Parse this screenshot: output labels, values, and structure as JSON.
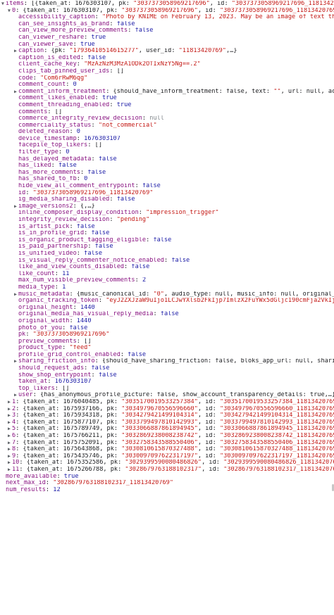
{
  "rows": [
    {
      "indent": 0,
      "tri": "down",
      "key": "items",
      "summary": "[{taken_at: 1676303107, pk: \"3037373058969217696\", id: \"3037373058969217696_1181342076\""
    },
    {
      "indent": 1,
      "tri": "down",
      "key": "0",
      "summary": "{taken_at: 1676303107, pk: \"3037373058969217696\", id: \"3037373058969217696_11813420769\","
    },
    {
      "indent": 2,
      "key": "accessibility_caption",
      "type": "s",
      "value": "\"Photo by KNIME on February 13, 2023. May be an image of text that"
    },
    {
      "indent": 2,
      "key": "can_see_insights_as_brand",
      "type": "b",
      "value": "false"
    },
    {
      "indent": 2,
      "key": "can_view_more_preview_comments",
      "type": "b",
      "value": "false"
    },
    {
      "indent": 2,
      "key": "can_viewer_reshare",
      "type": "b",
      "value": "true"
    },
    {
      "indent": 2,
      "key": "can_viewer_save",
      "type": "b",
      "value": "true"
    },
    {
      "indent": 2,
      "tri": "right",
      "key": "caption",
      "summary": "{pk: \"17936410514615277\", user_id: \"11813420769\",…}"
    },
    {
      "indent": 2,
      "key": "caption_is_edited",
      "type": "b",
      "value": "false"
    },
    {
      "indent": 2,
      "key": "client_cache_key",
      "type": "s",
      "value": "\"MzAzNzM3MzA1ODk2OTIxNzY5Ng==.2\""
    },
    {
      "indent": 2,
      "key": "clips_tab_pinned_user_ids",
      "type": "p",
      "value": "[]"
    },
    {
      "indent": 2,
      "key": "code",
      "type": "s",
      "value": "\"Com6rRwM6qg\""
    },
    {
      "indent": 2,
      "key": "comment_count",
      "type": "n",
      "value": "0"
    },
    {
      "indent": 2,
      "tri": "right",
      "key": "comment_inform_treatment",
      "summary": "{should_have_inform_treatment: false, text: \"\", url: null, acti"
    },
    {
      "indent": 2,
      "key": "comment_likes_enabled",
      "type": "b",
      "value": "true"
    },
    {
      "indent": 2,
      "key": "comment_threading_enabled",
      "type": "b",
      "value": "true"
    },
    {
      "indent": 2,
      "key": "comments",
      "type": "p",
      "value": "[]"
    },
    {
      "indent": 2,
      "key": "commerce_integrity_review_decision",
      "type": "nl",
      "value": "null"
    },
    {
      "indent": 2,
      "key": "commerciality_status",
      "type": "s",
      "value": "\"not_commercial\""
    },
    {
      "indent": 2,
      "key": "deleted_reason",
      "type": "n",
      "value": "0"
    },
    {
      "indent": 2,
      "key": "device_timestamp",
      "type": "n",
      "value": "1676303107"
    },
    {
      "indent": 2,
      "key": "facepile_top_likers",
      "type": "p",
      "value": "[]"
    },
    {
      "indent": 2,
      "key": "filter_type",
      "type": "n",
      "value": "0"
    },
    {
      "indent": 2,
      "key": "has_delayed_metadata",
      "type": "b",
      "value": "false"
    },
    {
      "indent": 2,
      "key": "has_liked",
      "type": "b",
      "value": "false"
    },
    {
      "indent": 2,
      "key": "has_more_comments",
      "type": "b",
      "value": "false"
    },
    {
      "indent": 2,
      "key": "has_shared_to_fb",
      "type": "n",
      "value": "0"
    },
    {
      "indent": 2,
      "key": "hide_view_all_comment_entrypoint",
      "type": "b",
      "value": "false"
    },
    {
      "indent": 2,
      "key": "id",
      "type": "s",
      "value": "\"3037373058969217696_11813420769\""
    },
    {
      "indent": 2,
      "key": "ig_media_sharing_disabled",
      "type": "b",
      "value": "false"
    },
    {
      "indent": 2,
      "tri": "right",
      "key": "image_versions2",
      "summary": "{,…}"
    },
    {
      "indent": 2,
      "key": "inline_composer_display_condition",
      "type": "s",
      "value": "\"impression_trigger\""
    },
    {
      "indent": 2,
      "key": "integrity_review_decision",
      "type": "s",
      "value": "\"pending\""
    },
    {
      "indent": 2,
      "key": "is_artist_pick",
      "type": "b",
      "value": "false"
    },
    {
      "indent": 2,
      "key": "is_in_profile_grid",
      "type": "b",
      "value": "false"
    },
    {
      "indent": 2,
      "key": "is_organic_product_tagging_eligible",
      "type": "b",
      "value": "false"
    },
    {
      "indent": 2,
      "key": "is_paid_partnership",
      "type": "b",
      "value": "false"
    },
    {
      "indent": 2,
      "key": "is_unified_video",
      "type": "b",
      "value": "false"
    },
    {
      "indent": 2,
      "key": "is_visual_reply_commenter_notice_enabled",
      "type": "b",
      "value": "false"
    },
    {
      "indent": 2,
      "key": "like_and_view_counts_disabled",
      "type": "b",
      "value": "false"
    },
    {
      "indent": 2,
      "key": "like_count",
      "type": "n",
      "value": "11"
    },
    {
      "indent": 2,
      "key": "max_num_visible_preview_comments",
      "type": "n",
      "value": "2"
    },
    {
      "indent": 2,
      "key": "media_type",
      "type": "n",
      "value": "1"
    },
    {
      "indent": 2,
      "tri": "right",
      "key": "music_metadata",
      "summary": "{music_canonical_id: \"0\", audio_type: null, music_info: null, original_so"
    },
    {
      "indent": 2,
      "key": "organic_tracking_token",
      "type": "s",
      "value": "\"eyJ2ZXJzaW9uIjo1LCJwYXlsb2FkIjp7ImlzX2FuYWx5dGljc190cmFja2VkIjp0"
    },
    {
      "indent": 2,
      "key": "original_height",
      "type": "n",
      "value": "1440"
    },
    {
      "indent": 2,
      "key": "original_media_has_visual_reply_media",
      "type": "b",
      "value": "false"
    },
    {
      "indent": 2,
      "key": "original_width",
      "type": "n",
      "value": "1440"
    },
    {
      "indent": 2,
      "key": "photo_of_you",
      "type": "b",
      "value": "false"
    },
    {
      "indent": 2,
      "key": "pk",
      "type": "s",
      "value": "\"3037373058969217696\""
    },
    {
      "indent": 2,
      "key": "preview_comments",
      "type": "p",
      "value": "[]"
    },
    {
      "indent": 2,
      "key": "product_type",
      "type": "s",
      "value": "\"feed\""
    },
    {
      "indent": 2,
      "key": "profile_grid_control_enabled",
      "type": "b",
      "value": "false"
    },
    {
      "indent": 2,
      "tri": "right",
      "key": "sharing_friction_info",
      "summary": "{should_have_sharing_friction: false, bloks_app_url: null, sharing"
    },
    {
      "indent": 2,
      "key": "should_request_ads",
      "type": "b",
      "value": "false"
    },
    {
      "indent": 2,
      "key": "show_shop_entrypoint",
      "type": "b",
      "value": "false"
    },
    {
      "indent": 2,
      "key": "taken_at",
      "type": "n",
      "value": "1676303107"
    },
    {
      "indent": 2,
      "key": "top_likers",
      "type": "p",
      "value": "[]"
    },
    {
      "indent": 2,
      "tri": "right",
      "key": "user",
      "summary": "{has_anonymous_profile_picture: false, show_account_transparency_details: true,…}"
    },
    {
      "indent": 1,
      "tri": "right",
      "key": "1",
      "summary": "{taken_at: 1676040485, pk: \"3035170019533257384\", id: \"3035170019533257384_11813420769\","
    },
    {
      "indent": 1,
      "tri": "right",
      "key": "2",
      "summary": "{taken_at: 1675937166, pk: \"3034979670556596660\", id: \"3034979670556596660_11813420769\","
    },
    {
      "indent": 1,
      "tri": "right",
      "key": "3",
      "summary": "{taken_at: 1675934318, pk: \"3034279421499104314\", id: \"3034279421499104314_11813420769\","
    },
    {
      "indent": 1,
      "tri": "right",
      "key": "4",
      "summary": "{taken_at: 1675877107, pk: \"3033799497810142993\", id: \"3033799497810142993_11813420769\","
    },
    {
      "indent": 1,
      "tri": "right",
      "key": "5",
      "summary": "{taken_at: 1675789749, pk: \"3033066887861894945\", id: \"3033066887861894945_11813420769\","
    },
    {
      "indent": 1,
      "tri": "right",
      "key": "6",
      "summary": "{taken_at: 1675766211, pk: \"3032869238008238742\", id: \"3032869238008238742_11813420769\","
    },
    {
      "indent": 1,
      "tri": "right",
      "key": "7",
      "summary": "{taken_at: 1675752091, pk: \"3032758343588550406\", id: \"3032758343588550406_11813420769\","
    },
    {
      "indent": 1,
      "tri": "right",
      "key": "8",
      "summary": "{taken_at: 1675643868, pk: \"3030810615870327488\", id: \"3030810615870327488_11813420769\","
    },
    {
      "indent": 1,
      "tri": "right",
      "key": "9",
      "summary": "{taken_at: 1675435746, pk: \"3030097097622317197\", id: \"3030097097622317197_11813420769\","
    },
    {
      "indent": 1,
      "tri": "right",
      "key": "10",
      "summary": "{taken_at: 1675352586, pk: \"3029399590080486826\", id: \"3029399590080486826_11813420769\","
    },
    {
      "indent": 1,
      "tri": "right",
      "key": "11",
      "summary": "{taken_at: 1675266788, pk: \"3028679763188102317\", id: \"3028679763188102317_11813420769\","
    },
    {
      "indent": 0,
      "key": "more_available",
      "type": "b",
      "value": "true"
    },
    {
      "indent": 0,
      "key": "next_max_id",
      "type": "s",
      "value": "\"3028679763188102317_11813420769\""
    },
    {
      "indent": 0,
      "key": "num_results",
      "type": "n",
      "value": "12"
    }
  ]
}
